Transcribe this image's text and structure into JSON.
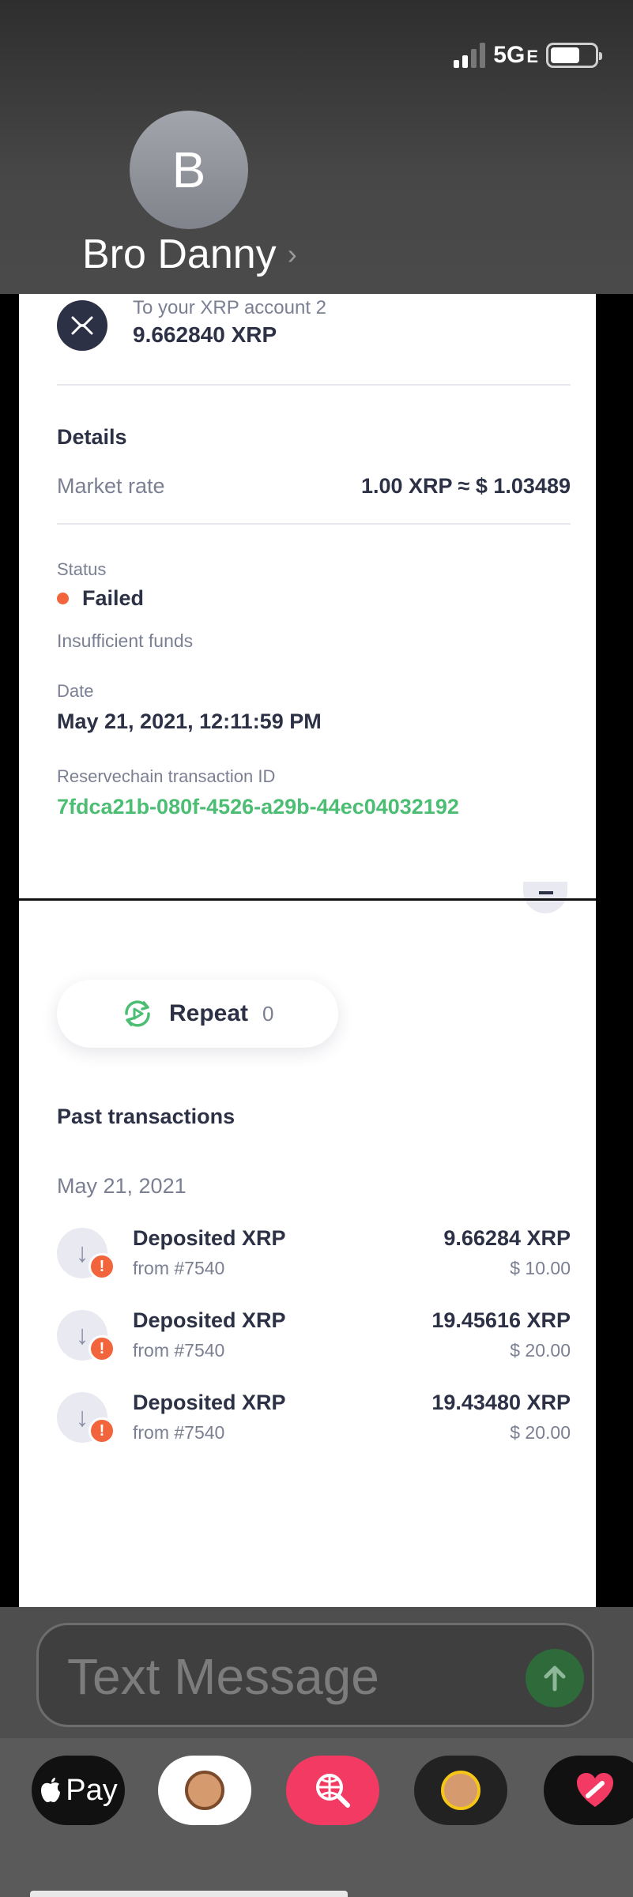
{
  "status_bar": {
    "network": "5G",
    "network_suffix": "E"
  },
  "contact": {
    "initial": "B",
    "name": "Bro Danny",
    "chevron": ">"
  },
  "transfer": {
    "icon": "xrp-logo-icon",
    "to_label": "To your XRP account 2",
    "amount": "9.662840 XRP"
  },
  "details": {
    "title": "Details",
    "market_rate_label": "Market rate",
    "market_rate_value": "1.00 XRP ≈ $ 1.03489",
    "status_label": "Status",
    "status_value": "Failed",
    "status_reason": "Insufficient funds",
    "date_label": "Date",
    "date_value": "May 21, 2021, 12:11:59 PM",
    "txid_label": "Reservechain transaction ID",
    "txid_value": "7fdca21b-080f-4526-a29b-44ec04032192"
  },
  "repeat": {
    "label": "Repeat",
    "count": "0"
  },
  "past": {
    "title": "Past transactions",
    "date": "May 21, 2021",
    "items": [
      {
        "title": "Deposited XRP",
        "from": "from #7540",
        "amount": "9.66284 XRP",
        "fiat": "$ 10.00"
      },
      {
        "title": "Deposited XRP",
        "from": "from #7540",
        "amount": "19.45616 XRP",
        "fiat": "$ 20.00"
      },
      {
        "title": "Deposited XRP",
        "from": "from #7540",
        "amount": "19.43480 XRP",
        "fiat": "$ 20.00"
      }
    ]
  },
  "composer": {
    "placeholder": "Text Message"
  },
  "drawer": {
    "apple_pay_label": "Pay"
  },
  "colors": {
    "accent_green": "#4cbe73",
    "failed_orange": "#f2643b",
    "text_dark": "#2d3146"
  }
}
